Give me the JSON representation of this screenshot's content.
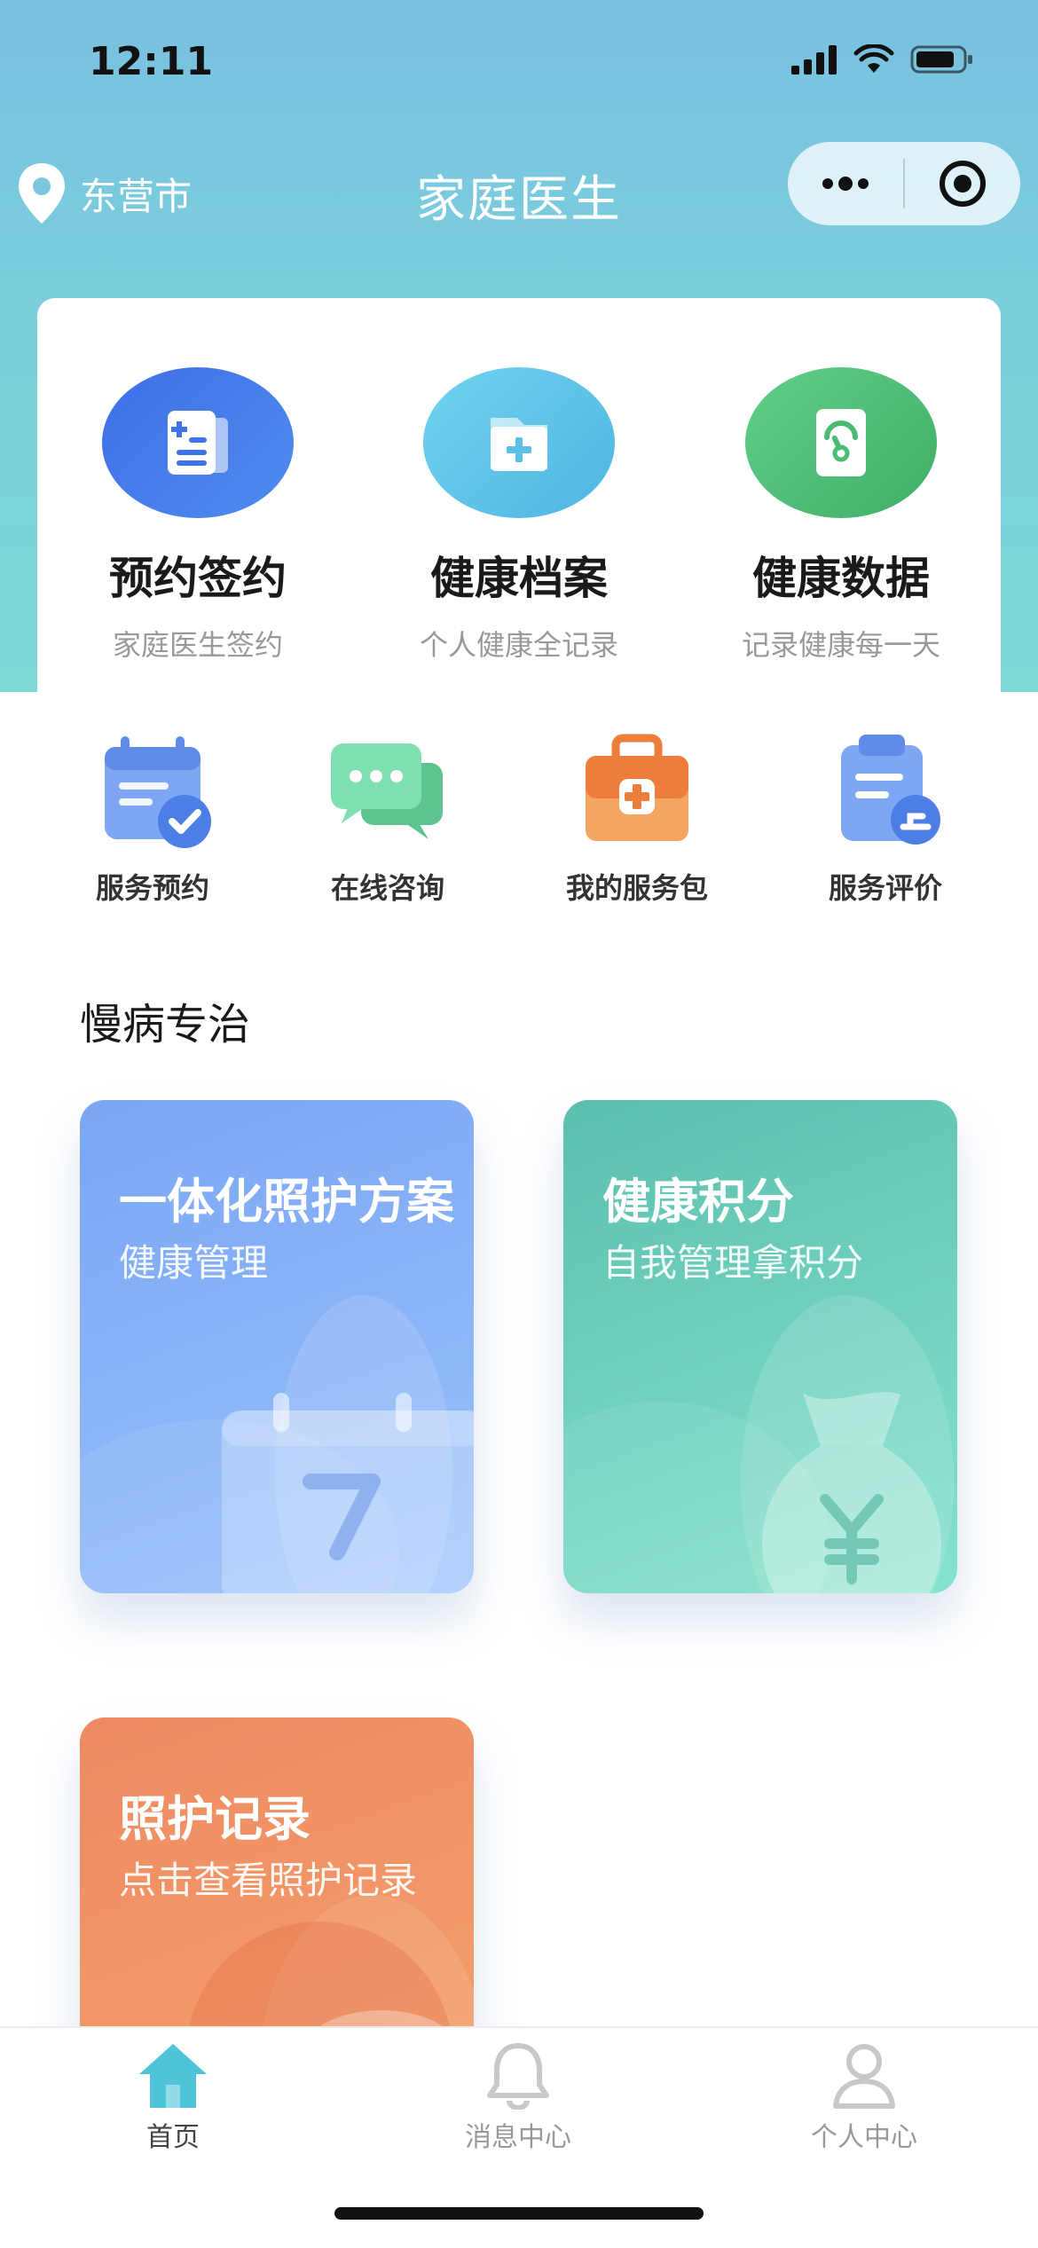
{
  "status_bar": {
    "time": "12:11"
  },
  "nav": {
    "location": "东营市",
    "title": "家庭医生"
  },
  "features": [
    {
      "title": "预约签约",
      "subtitle": "家庭医生签约",
      "icon": "document-list-icon",
      "color": "#3f73ea"
    },
    {
      "title": "健康档案",
      "subtitle": "个人健康全记录",
      "icon": "folder-plus-icon",
      "color": "#5cc0e6"
    },
    {
      "title": "健康数据",
      "subtitle": "记录健康每一天",
      "icon": "gauge-report-icon",
      "color": "#4cbb72"
    }
  ],
  "quick_actions": [
    {
      "label": "服务预约",
      "icon": "calendar-check-icon"
    },
    {
      "label": "在线咨询",
      "icon": "chat-bubbles-icon"
    },
    {
      "label": "我的服务包",
      "icon": "medical-kit-icon"
    },
    {
      "label": "服务评价",
      "icon": "clipboard-review-icon"
    }
  ],
  "section": {
    "title": "慢病专治"
  },
  "tiles": [
    {
      "title": "一体化照护方案",
      "subtitle": "健康管理",
      "icon": "calendar-icon"
    },
    {
      "title": "健康积分",
      "subtitle": "自我管理拿积分",
      "icon": "money-bag-icon"
    },
    {
      "title": "照护记录",
      "subtitle": "点击查看照护记录",
      "icon": "care-record-icon"
    }
  ],
  "tabbar": [
    {
      "label": "首页",
      "icon": "home-icon",
      "active": true
    },
    {
      "label": "消息中心",
      "icon": "bell-icon",
      "active": false
    },
    {
      "label": "个人中心",
      "icon": "user-icon",
      "active": false
    }
  ],
  "colors": {
    "hero": "#7cc8de",
    "tile_blue": "#7aa8f5",
    "tile_green": "#5ec7ae",
    "tile_orange": "#f08a5d",
    "tab_active": "#4fc3d8"
  }
}
